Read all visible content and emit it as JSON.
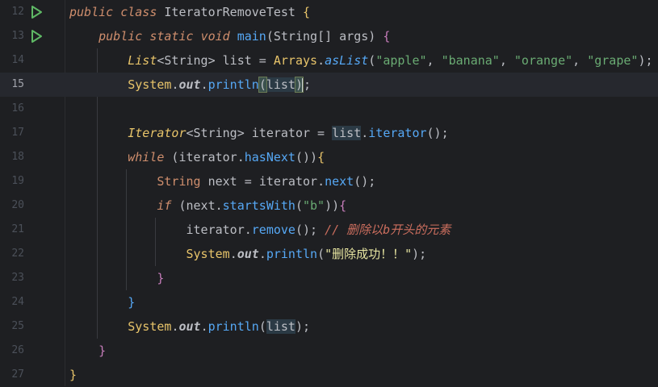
{
  "editor": {
    "lines": [
      {
        "num": "12",
        "has_run": true
      },
      {
        "num": "13",
        "has_run": true
      },
      {
        "num": "14",
        "has_run": false
      },
      {
        "num": "15",
        "has_run": false,
        "current": true
      },
      {
        "num": "16",
        "has_run": false
      },
      {
        "num": "17",
        "has_run": false
      },
      {
        "num": "18",
        "has_run": false
      },
      {
        "num": "19",
        "has_run": false
      },
      {
        "num": "20",
        "has_run": false
      },
      {
        "num": "21",
        "has_run": false
      },
      {
        "num": "22",
        "has_run": false
      },
      {
        "num": "23",
        "has_run": false
      },
      {
        "num": "24",
        "has_run": false
      },
      {
        "num": "25",
        "has_run": false
      },
      {
        "num": "26",
        "has_run": false
      },
      {
        "num": "27",
        "has_run": false
      }
    ],
    "tokens": {
      "public": "public",
      "class": "class",
      "class_name": "IteratorRemoveTest",
      "static": "static",
      "void": "void",
      "main": "main",
      "string_type": "String",
      "array_brackets": "[]",
      "args": "args",
      "list_type": "List",
      "generic_string": "<String>",
      "list_var": "list",
      "arrays": "Arrays",
      "as_list": "asList",
      "s_apple": "\"apple\"",
      "s_banana": "\"banana\"",
      "s_orange": "\"orange\"",
      "s_grape": "\"grape\"",
      "system": "System",
      "out": "out",
      "println": "println",
      "iterator_type": "Iterator",
      "iterator_var": "iterator",
      "iterator_method": "iterator",
      "while": "while",
      "has_next": "hasNext",
      "next_var": "next",
      "next_method": "next",
      "if": "if",
      "starts_with": "startsWith",
      "s_b": "\"b\"",
      "remove": "remove",
      "comment": "// 删除以b开头的元素",
      "s_success": "\"删除成功！！\""
    },
    "colors": {
      "background": "#1e1f22",
      "keyword": "#cf8e6d",
      "string": "#6aab73",
      "method": "#56a8f5",
      "field": "#c77dbb",
      "comment": "#cc6e5e",
      "run_icon": "#5fb865"
    },
    "icons": {
      "run": "run-gutter-icon"
    }
  }
}
